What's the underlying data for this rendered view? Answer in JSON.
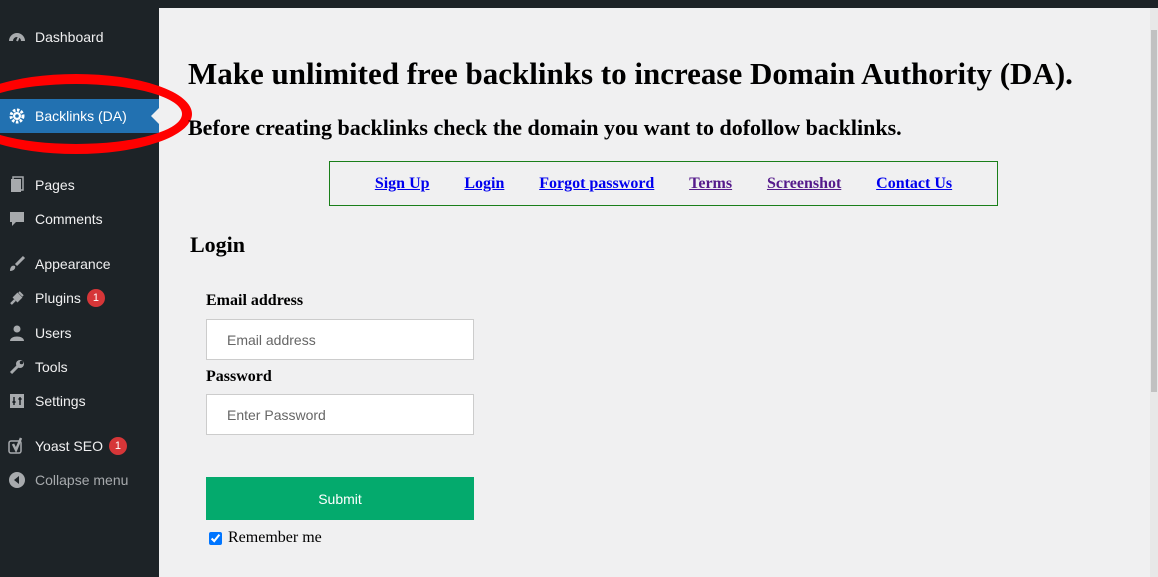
{
  "sidebar": {
    "items": [
      {
        "label": "Dashboard",
        "icon": "dashboard-icon"
      },
      {
        "label": "Backlinks (DA)",
        "icon": "gear-icon",
        "active": true
      },
      {
        "label": "Pages",
        "icon": "pages-icon"
      },
      {
        "label": "Comments",
        "icon": "comment-icon"
      },
      {
        "label": "Appearance",
        "icon": "paintbrush-icon"
      },
      {
        "label": "Plugins",
        "icon": "plug-icon",
        "badge": "1"
      },
      {
        "label": "Users",
        "icon": "user-icon"
      },
      {
        "label": "Tools",
        "icon": "wrench-icon"
      },
      {
        "label": "Settings",
        "icon": "settings-icon"
      },
      {
        "label": "Yoast SEO",
        "icon": "yoast-icon",
        "badge": "1"
      },
      {
        "label": "Collapse menu",
        "icon": "collapse-icon"
      }
    ]
  },
  "main": {
    "headline": "Make unlimited free backlinks to increase Domain Authority (DA).",
    "subheadline": "Before creating backlinks check the domain you want to dofollow backlinks.",
    "links": [
      "Sign Up",
      "Login",
      "Forgot password",
      "Terms",
      "Screenshot",
      "Contact Us"
    ],
    "form": {
      "heading": "Login",
      "email_label": "Email address",
      "email_placeholder": "Email address",
      "password_label": "Password",
      "password_placeholder": "Enter Password",
      "submit_label": "Submit",
      "remember_label": "Remember me",
      "remember_checked": true
    }
  },
  "colors": {
    "sidebar_bg": "#1d2327",
    "active_bg": "#2271b1",
    "submit_bg": "#04aa6d",
    "annotation": "#ff0000"
  }
}
